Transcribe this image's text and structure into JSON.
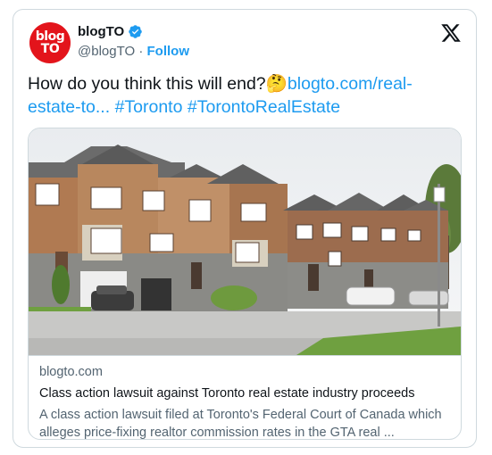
{
  "account": {
    "avatar_line1": "blog",
    "avatar_line2": "TO",
    "name": "blogTO",
    "handle": "@blogTO",
    "separator": " · ",
    "follow_label": "Follow"
  },
  "tweet": {
    "text": "How do you think this will end?",
    "emoji": "🤔",
    "link": "blogto.com/real-estate-to...",
    "hashtags": [
      "#Toronto",
      "#TorontoRealEstate"
    ]
  },
  "link_card": {
    "domain": "blogto.com",
    "title": "Class action lawsuit against Toronto real estate industry proceeds",
    "description": "A class action lawsuit filed at Toronto's Federal Court of Canada which alleges price-fixing realtor commission rates in the GTA real ..."
  },
  "colors": {
    "brand_red": "#e3141b",
    "link_blue": "#1d9bf0",
    "verified_blue": "#1d9bf0"
  },
  "icons": [
    "verified-badge-icon",
    "x-logo-icon",
    "thinking-face-emoji"
  ]
}
